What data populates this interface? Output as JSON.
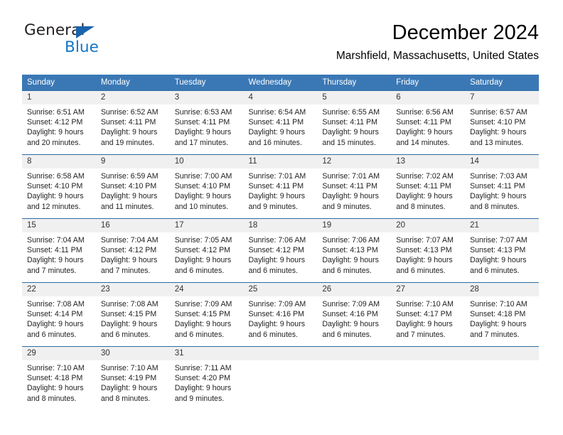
{
  "brand": {
    "name_part1": "General",
    "name_part2": "Blue",
    "accent_color": "#1275c4",
    "triangle_color": "#1b63ad",
    "triangle_icon": "triangle-icon"
  },
  "header": {
    "title": "December 2024",
    "subtitle": "Marshfield, Massachusetts, United States"
  },
  "theme": {
    "header_row_bg": "#3a78b5",
    "daynum_bg": "#f0f0f0",
    "row_divider": "#2e6da4"
  },
  "weekdays": [
    "Sunday",
    "Monday",
    "Tuesday",
    "Wednesday",
    "Thursday",
    "Friday",
    "Saturday"
  ],
  "weeks": [
    [
      {
        "day": "1",
        "sunrise": "Sunrise: 6:51 AM",
        "sunset": "Sunset: 4:12 PM",
        "daylight": "Daylight: 9 hours",
        "daylight2": "and 20 minutes."
      },
      {
        "day": "2",
        "sunrise": "Sunrise: 6:52 AM",
        "sunset": "Sunset: 4:11 PM",
        "daylight": "Daylight: 9 hours",
        "daylight2": "and 19 minutes."
      },
      {
        "day": "3",
        "sunrise": "Sunrise: 6:53 AM",
        "sunset": "Sunset: 4:11 PM",
        "daylight": "Daylight: 9 hours",
        "daylight2": "and 17 minutes."
      },
      {
        "day": "4",
        "sunrise": "Sunrise: 6:54 AM",
        "sunset": "Sunset: 4:11 PM",
        "daylight": "Daylight: 9 hours",
        "daylight2": "and 16 minutes."
      },
      {
        "day": "5",
        "sunrise": "Sunrise: 6:55 AM",
        "sunset": "Sunset: 4:11 PM",
        "daylight": "Daylight: 9 hours",
        "daylight2": "and 15 minutes."
      },
      {
        "day": "6",
        "sunrise": "Sunrise: 6:56 AM",
        "sunset": "Sunset: 4:11 PM",
        "daylight": "Daylight: 9 hours",
        "daylight2": "and 14 minutes."
      },
      {
        "day": "7",
        "sunrise": "Sunrise: 6:57 AM",
        "sunset": "Sunset: 4:10 PM",
        "daylight": "Daylight: 9 hours",
        "daylight2": "and 13 minutes."
      }
    ],
    [
      {
        "day": "8",
        "sunrise": "Sunrise: 6:58 AM",
        "sunset": "Sunset: 4:10 PM",
        "daylight": "Daylight: 9 hours",
        "daylight2": "and 12 minutes."
      },
      {
        "day": "9",
        "sunrise": "Sunrise: 6:59 AM",
        "sunset": "Sunset: 4:10 PM",
        "daylight": "Daylight: 9 hours",
        "daylight2": "and 11 minutes."
      },
      {
        "day": "10",
        "sunrise": "Sunrise: 7:00 AM",
        "sunset": "Sunset: 4:10 PM",
        "daylight": "Daylight: 9 hours",
        "daylight2": "and 10 minutes."
      },
      {
        "day": "11",
        "sunrise": "Sunrise: 7:01 AM",
        "sunset": "Sunset: 4:11 PM",
        "daylight": "Daylight: 9 hours",
        "daylight2": "and 9 minutes."
      },
      {
        "day": "12",
        "sunrise": "Sunrise: 7:01 AM",
        "sunset": "Sunset: 4:11 PM",
        "daylight": "Daylight: 9 hours",
        "daylight2": "and 9 minutes."
      },
      {
        "day": "13",
        "sunrise": "Sunrise: 7:02 AM",
        "sunset": "Sunset: 4:11 PM",
        "daylight": "Daylight: 9 hours",
        "daylight2": "and 8 minutes."
      },
      {
        "day": "14",
        "sunrise": "Sunrise: 7:03 AM",
        "sunset": "Sunset: 4:11 PM",
        "daylight": "Daylight: 9 hours",
        "daylight2": "and 8 minutes."
      }
    ],
    [
      {
        "day": "15",
        "sunrise": "Sunrise: 7:04 AM",
        "sunset": "Sunset: 4:11 PM",
        "daylight": "Daylight: 9 hours",
        "daylight2": "and 7 minutes."
      },
      {
        "day": "16",
        "sunrise": "Sunrise: 7:04 AM",
        "sunset": "Sunset: 4:12 PM",
        "daylight": "Daylight: 9 hours",
        "daylight2": "and 7 minutes."
      },
      {
        "day": "17",
        "sunrise": "Sunrise: 7:05 AM",
        "sunset": "Sunset: 4:12 PM",
        "daylight": "Daylight: 9 hours",
        "daylight2": "and 6 minutes."
      },
      {
        "day": "18",
        "sunrise": "Sunrise: 7:06 AM",
        "sunset": "Sunset: 4:12 PM",
        "daylight": "Daylight: 9 hours",
        "daylight2": "and 6 minutes."
      },
      {
        "day": "19",
        "sunrise": "Sunrise: 7:06 AM",
        "sunset": "Sunset: 4:13 PM",
        "daylight": "Daylight: 9 hours",
        "daylight2": "and 6 minutes."
      },
      {
        "day": "20",
        "sunrise": "Sunrise: 7:07 AM",
        "sunset": "Sunset: 4:13 PM",
        "daylight": "Daylight: 9 hours",
        "daylight2": "and 6 minutes."
      },
      {
        "day": "21",
        "sunrise": "Sunrise: 7:07 AM",
        "sunset": "Sunset: 4:13 PM",
        "daylight": "Daylight: 9 hours",
        "daylight2": "and 6 minutes."
      }
    ],
    [
      {
        "day": "22",
        "sunrise": "Sunrise: 7:08 AM",
        "sunset": "Sunset: 4:14 PM",
        "daylight": "Daylight: 9 hours",
        "daylight2": "and 6 minutes."
      },
      {
        "day": "23",
        "sunrise": "Sunrise: 7:08 AM",
        "sunset": "Sunset: 4:15 PM",
        "daylight": "Daylight: 9 hours",
        "daylight2": "and 6 minutes."
      },
      {
        "day": "24",
        "sunrise": "Sunrise: 7:09 AM",
        "sunset": "Sunset: 4:15 PM",
        "daylight": "Daylight: 9 hours",
        "daylight2": "and 6 minutes."
      },
      {
        "day": "25",
        "sunrise": "Sunrise: 7:09 AM",
        "sunset": "Sunset: 4:16 PM",
        "daylight": "Daylight: 9 hours",
        "daylight2": "and 6 minutes."
      },
      {
        "day": "26",
        "sunrise": "Sunrise: 7:09 AM",
        "sunset": "Sunset: 4:16 PM",
        "daylight": "Daylight: 9 hours",
        "daylight2": "and 6 minutes."
      },
      {
        "day": "27",
        "sunrise": "Sunrise: 7:10 AM",
        "sunset": "Sunset: 4:17 PM",
        "daylight": "Daylight: 9 hours",
        "daylight2": "and 7 minutes."
      },
      {
        "day": "28",
        "sunrise": "Sunrise: 7:10 AM",
        "sunset": "Sunset: 4:18 PM",
        "daylight": "Daylight: 9 hours",
        "daylight2": "and 7 minutes."
      }
    ],
    [
      {
        "day": "29",
        "sunrise": "Sunrise: 7:10 AM",
        "sunset": "Sunset: 4:18 PM",
        "daylight": "Daylight: 9 hours",
        "daylight2": "and 8 minutes."
      },
      {
        "day": "30",
        "sunrise": "Sunrise: 7:10 AM",
        "sunset": "Sunset: 4:19 PM",
        "daylight": "Daylight: 9 hours",
        "daylight2": "and 8 minutes."
      },
      {
        "day": "31",
        "sunrise": "Sunrise: 7:11 AM",
        "sunset": "Sunset: 4:20 PM",
        "daylight": "Daylight: 9 hours",
        "daylight2": "and 9 minutes."
      },
      {
        "day": "",
        "sunrise": "",
        "sunset": "",
        "daylight": "",
        "daylight2": ""
      },
      {
        "day": "",
        "sunrise": "",
        "sunset": "",
        "daylight": "",
        "daylight2": ""
      },
      {
        "day": "",
        "sunrise": "",
        "sunset": "",
        "daylight": "",
        "daylight2": ""
      },
      {
        "day": "",
        "sunrise": "",
        "sunset": "",
        "daylight": "",
        "daylight2": ""
      }
    ]
  ]
}
